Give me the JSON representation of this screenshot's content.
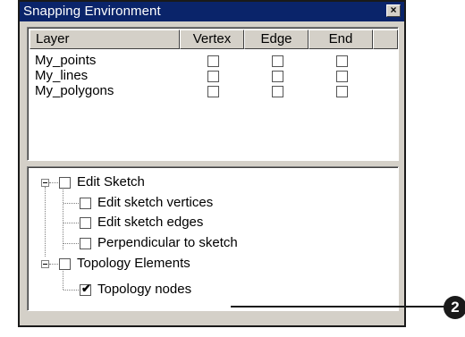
{
  "window": {
    "title": "Snapping Environment",
    "close_glyph": "×"
  },
  "table": {
    "headers": [
      "Layer",
      "Vertex",
      "Edge",
      "End"
    ],
    "rows": [
      {
        "layer": "My_points",
        "vertex": false,
        "edge": false,
        "end": false
      },
      {
        "layer": "My_lines",
        "vertex": false,
        "edge": false,
        "end": false
      },
      {
        "layer": "My_polygons",
        "vertex": false,
        "edge": false,
        "end": false
      }
    ]
  },
  "tree": {
    "edit_sketch": {
      "label": "Edit Sketch",
      "checked": false,
      "expanded": true
    },
    "edit_sketch_vertices": {
      "label": "Edit sketch vertices",
      "checked": false
    },
    "edit_sketch_edges": {
      "label": "Edit sketch edges",
      "checked": false
    },
    "perpendicular": {
      "label": "Perpendicular to sketch",
      "checked": false
    },
    "topology_elements": {
      "label": "Topology Elements",
      "checked": false,
      "expanded": true
    },
    "topology_nodes": {
      "label": "Topology nodes",
      "checked": true,
      "check_glyph": "✔"
    }
  },
  "callout": {
    "number": "2"
  }
}
